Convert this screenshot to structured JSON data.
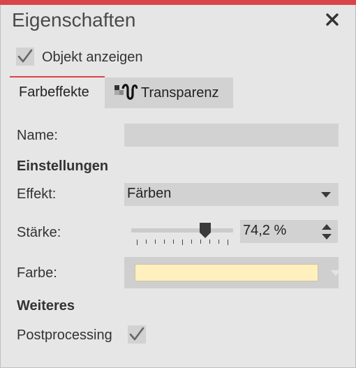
{
  "panel": {
    "title": "Eigenschaften",
    "accent_color": "#d9444a",
    "close_icon": "close-icon"
  },
  "show_object": {
    "label": "Objekt anzeigen",
    "checked": true
  },
  "tabs": [
    {
      "label": "Farbeffekte",
      "active": true
    },
    {
      "label": "Transparenz",
      "icon": "transparency-icon",
      "active": false
    }
  ],
  "form": {
    "name_label": "Name:",
    "name_value": "",
    "section_settings": "Einstellungen",
    "effect_label": "Effekt:",
    "effect_value": "Färben",
    "strength_label": "Stärke:",
    "strength_value": "74,2 %",
    "strength_level_percent": 74.2,
    "color_label": "Farbe:",
    "color_value": "#fff0be",
    "section_more": "Weiteres",
    "postprocessing_label": "Postprocessing",
    "postprocessing_checked": true
  }
}
